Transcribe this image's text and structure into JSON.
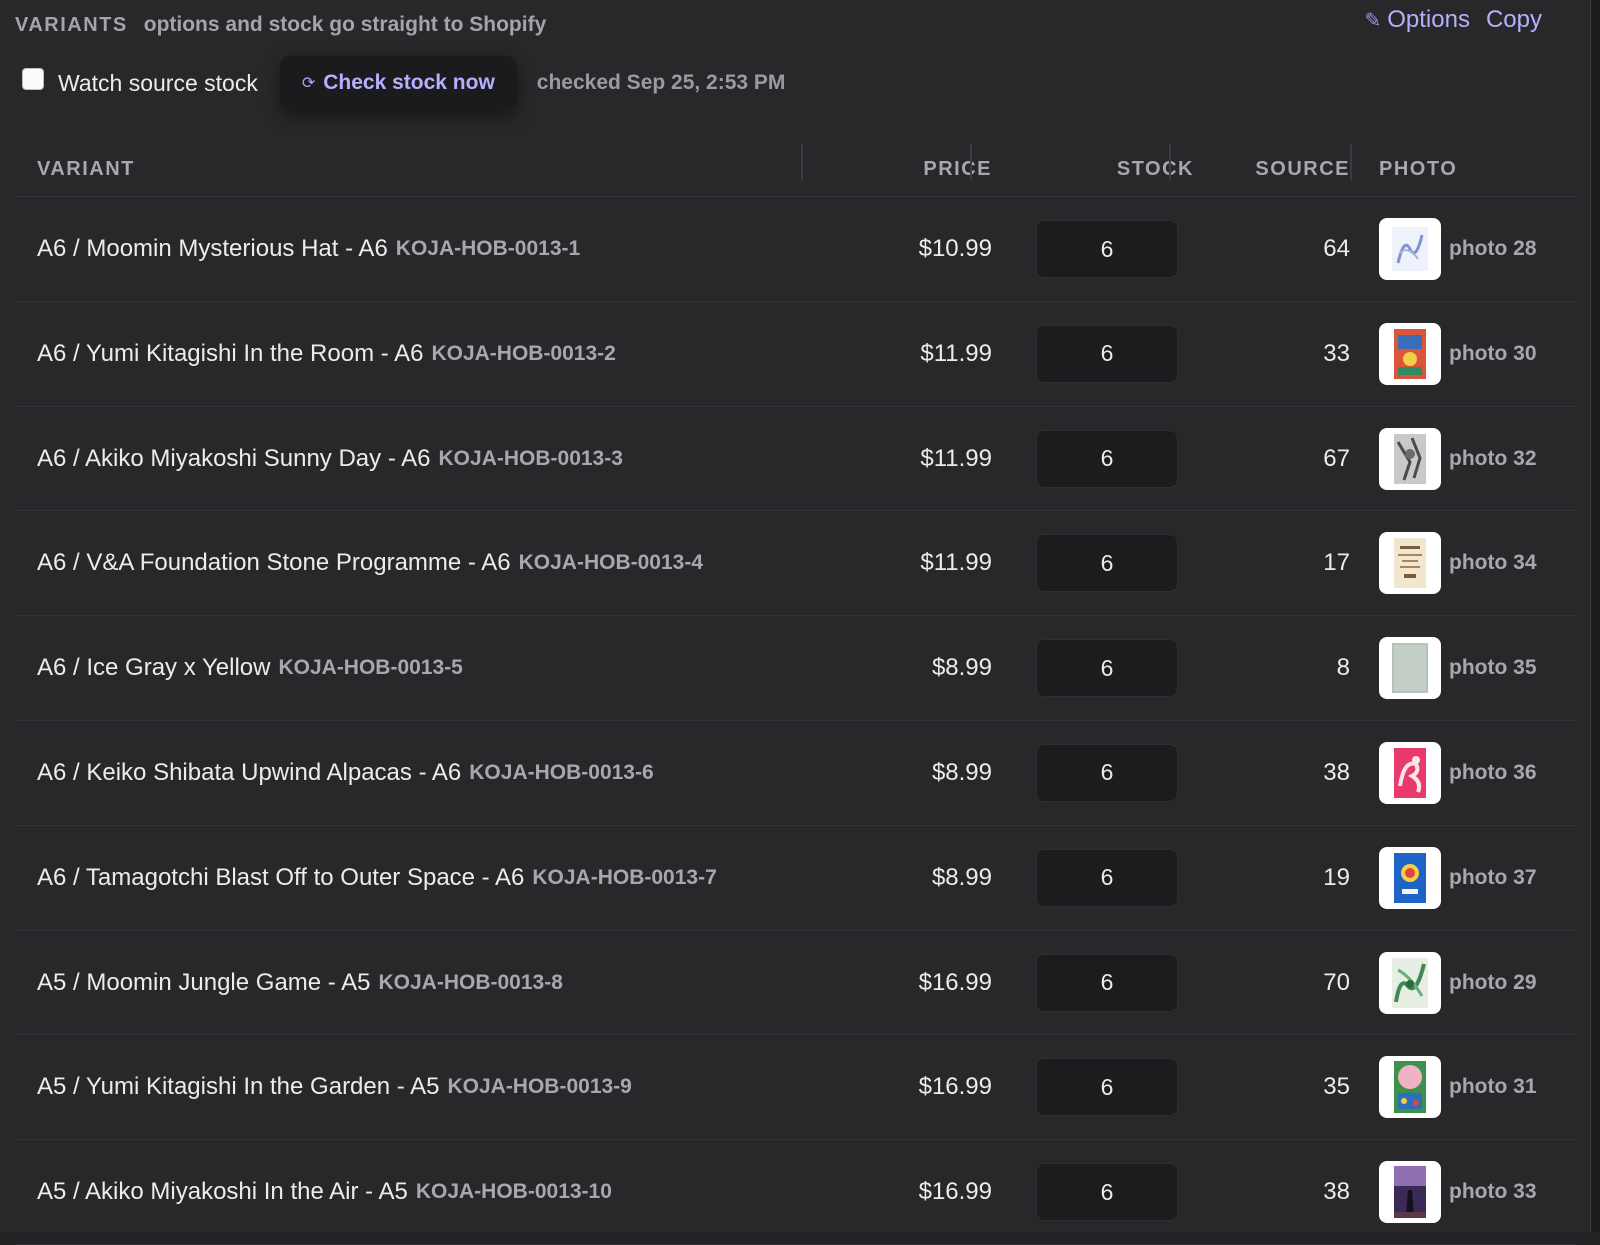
{
  "header": {
    "section_label": "VARIANTS",
    "section_sub": "options and stock go straight to Shopify",
    "options_label": "Options",
    "copy_label": "Copy"
  },
  "toolbar": {
    "watch_label": "Watch source stock",
    "watch_checked": false,
    "check_label": "Check stock now",
    "checked_time": "checked Sep 25, 2:53 PM"
  },
  "table": {
    "columns": [
      "VARIANT",
      "PRICE",
      "STOCK",
      "SOURCE",
      "PHOTO"
    ],
    "rows": [
      {
        "name": "A6 / Moomin Mysterious Hat - A6",
        "sku": "KOJA-HOB-0013-1",
        "price": "$10.99",
        "stock": "6",
        "source": "64",
        "photo": "photo 28",
        "thumb": "blue-sketch"
      },
      {
        "name": "A6 / Yumi Kitagishi In the Room - A6",
        "sku": "KOJA-HOB-0013-2",
        "price": "$11.99",
        "stock": "6",
        "source": "33",
        "photo": "photo 30",
        "thumb": "colorful-room"
      },
      {
        "name": "A6 / Akiko Miyakoshi Sunny Day - A6",
        "sku": "KOJA-HOB-0013-3",
        "price": "$11.99",
        "stock": "6",
        "source": "67",
        "photo": "photo 32",
        "thumb": "gray-pencil"
      },
      {
        "name": "A6 / V&A Foundation Stone Programme - A6",
        "sku": "KOJA-HOB-0013-4",
        "price": "$11.99",
        "stock": "6",
        "source": "17",
        "photo": "photo 34",
        "thumb": "programme"
      },
      {
        "name": "A6 / Ice Gray x Yellow",
        "sku": "KOJA-HOB-0013-5",
        "price": "$8.99",
        "stock": "6",
        "source": "8",
        "photo": "photo 35",
        "thumb": "ice-gray"
      },
      {
        "name": "A6 / Keiko Shibata Upwind Alpacas - A6",
        "sku": "KOJA-HOB-0013-6",
        "price": "$8.99",
        "stock": "6",
        "source": "38",
        "photo": "photo 36",
        "thumb": "pink-alpaca"
      },
      {
        "name": "A6 / Tamagotchi Blast Off to Outer Space - A6",
        "sku": "KOJA-HOB-0013-7",
        "price": "$8.99",
        "stock": "6",
        "source": "19",
        "photo": "photo 37",
        "thumb": "blue-space"
      },
      {
        "name": "A5 / Moomin Jungle Game - A5",
        "sku": "KOJA-HOB-0013-8",
        "price": "$16.99",
        "stock": "6",
        "source": "70",
        "photo": "photo 29",
        "thumb": "green-jungle"
      },
      {
        "name": "A5 / Yumi Kitagishi In the Garden - A5",
        "sku": "KOJA-HOB-0013-9",
        "price": "$16.99",
        "stock": "6",
        "source": "35",
        "photo": "photo 31",
        "thumb": "garden"
      },
      {
        "name": "A5 / Akiko Miyakoshi In the Air - A5",
        "sku": "KOJA-HOB-0013-10",
        "price": "$16.99",
        "stock": "6",
        "source": "38",
        "photo": "photo 33",
        "thumb": "night-air"
      }
    ]
  }
}
